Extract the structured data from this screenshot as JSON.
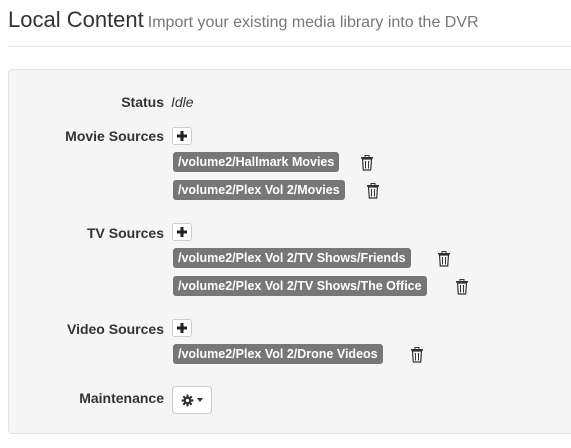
{
  "header": {
    "title": "Local Content",
    "subtitle": "Import your existing media library into the DVR"
  },
  "status": {
    "label": "Status",
    "value": "Idle"
  },
  "movie_sources": {
    "label": "Movie Sources",
    "paths": [
      "/volume2/Hallmark Movies",
      "/volume2/Plex Vol 2/Movies"
    ]
  },
  "tv_sources": {
    "label": "TV Sources",
    "paths": [
      "/volume2/Plex Vol 2/TV Shows/Friends",
      "/volume2/Plex Vol 2/TV Shows/The Office"
    ]
  },
  "video_sources": {
    "label": "Video Sources",
    "paths": [
      "/volume2/Plex Vol 2/Drone Videos"
    ]
  },
  "maintenance": {
    "label": "Maintenance"
  },
  "icons": {
    "add": "plus-icon",
    "delete": "trash-icon",
    "menu": "gear-icon"
  }
}
